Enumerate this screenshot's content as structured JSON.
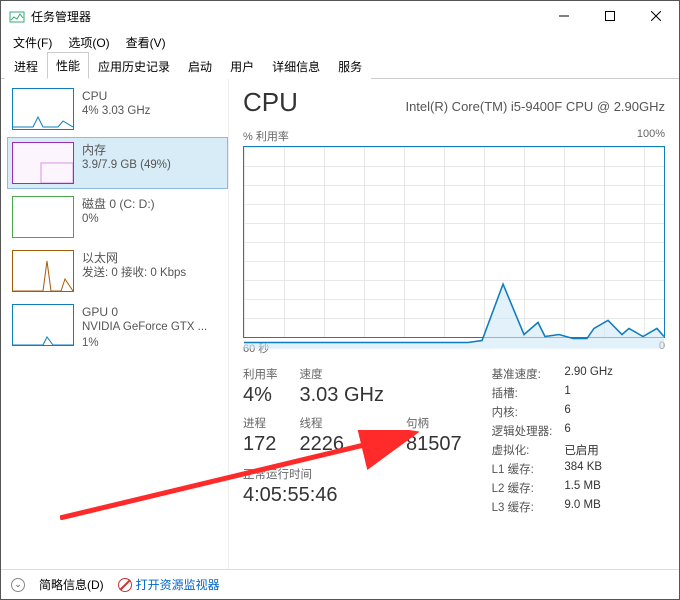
{
  "window": {
    "title": "任务管理器"
  },
  "menus": {
    "file": "文件(F)",
    "options": "选项(O)",
    "view": "查看(V)"
  },
  "tabs": {
    "processes": "进程",
    "performance": "性能",
    "app_history": "应用历史记录",
    "startup": "启动",
    "users": "用户",
    "details": "详细信息",
    "services": "服务"
  },
  "sidebar": {
    "cpu": {
      "title": "CPU",
      "sub": "4% 3.03 GHz"
    },
    "mem": {
      "title": "内存",
      "sub": "3.9/7.9 GB (49%)"
    },
    "disk": {
      "title": "磁盘 0 (C: D:)",
      "sub": "0%"
    },
    "eth": {
      "title": "以太网",
      "sub": "发送: 0 接收: 0 Kbps"
    },
    "gpu": {
      "title": "GPU 0",
      "sub1": "NVIDIA GeForce GTX ...",
      "sub2": "1%"
    }
  },
  "main": {
    "heading": "CPU",
    "model": "Intel(R) Core(TM) i5-9400F CPU @ 2.90GHz",
    "chart_top_left": "% 利用率",
    "chart_top_right": "100%",
    "chart_bottom_left": "60 秒",
    "chart_bottom_right": "0",
    "stats": {
      "util_l": "利用率",
      "util_v": "4%",
      "speed_l": "速度",
      "speed_v": "3.03 GHz",
      "proc_l": "进程",
      "proc_v": "172",
      "threads_l": "线程",
      "threads_v": "2226",
      "handles_l": "句柄",
      "handles_v": "81507",
      "uptime_l": "正常运行时间",
      "uptime_v": "4:05:55:46"
    },
    "right": {
      "base_l": "基准速度:",
      "base_v": "2.90 GHz",
      "sockets_l": "插槽:",
      "sockets_v": "1",
      "cores_l": "内核:",
      "cores_v": "6",
      "lproc_l": "逻辑处理器:",
      "lproc_v": "6",
      "virt_l": "虚拟化:",
      "virt_v": "已启用",
      "l1_l": "L1 缓存:",
      "l1_v": "384 KB",
      "l2_l": "L2 缓存:",
      "l2_v": "1.5 MB",
      "l3_l": "L3 缓存:",
      "l3_v": "9.0 MB"
    }
  },
  "footer": {
    "fewer": "简略信息(D)",
    "resmon": "打开资源监视器"
  },
  "chart_data": {
    "type": "line",
    "title": "% 利用率",
    "xlabel": "60 秒",
    "ylabel": "%",
    "ylim": [
      0,
      100
    ],
    "xlim": [
      60,
      0
    ],
    "x": [
      60,
      56,
      53,
      50,
      47,
      44,
      41,
      38,
      36,
      35,
      33,
      30,
      28,
      26,
      23,
      20,
      18,
      17,
      15,
      13,
      11,
      10,
      8,
      6,
      5,
      3,
      1,
      0
    ],
    "values": [
      3,
      3,
      3,
      3,
      3,
      3,
      3,
      3,
      3,
      3,
      3,
      3,
      3,
      4,
      32,
      7,
      13,
      6,
      7,
      5,
      5,
      10,
      14,
      7,
      10,
      6,
      10,
      6
    ]
  }
}
